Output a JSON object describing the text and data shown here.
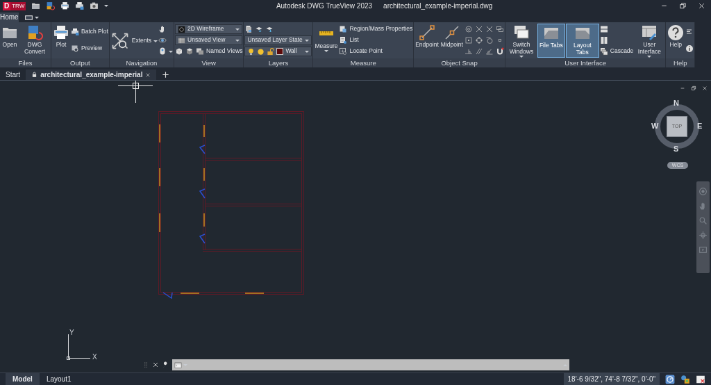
{
  "window": {
    "title": "Autodesk DWG TrueView 2023",
    "document": "architectural_example-imperial.dwg"
  },
  "logo": {
    "letter": "D",
    "text": "TRW"
  },
  "ribbon_tabs": [
    {
      "label": "Home",
      "selected": true
    },
    {
      "kind": "icon",
      "selected": false
    }
  ],
  "panels": [
    {
      "title": "Files",
      "columns": [
        {
          "kind": "large",
          "label": "Open"
        },
        {
          "kind": "large",
          "label": "DWG Convert"
        }
      ]
    },
    {
      "title": "Output",
      "columns": [
        {
          "kind": "large",
          "label": "Plot"
        },
        {
          "kind": "stack",
          "rows": [
            [
              {
                "kind": "small",
                "label": "Batch Plot"
              }
            ],
            [
              {
                "kind": "small",
                "label": "Preview"
              }
            ]
          ]
        }
      ]
    },
    {
      "title": "Navigation",
      "columns": [
        {
          "kind": "wide",
          "label": "Extents",
          "menu": true
        },
        {
          "kind": "stack",
          "rows": [
            [
              {
                "kind": "icon"
              }
            ],
            [
              {
                "kind": "icon"
              }
            ],
            [
              {
                "kind": "icon",
                "menu": true
              }
            ]
          ]
        }
      ]
    },
    {
      "title": "View",
      "columns": [
        {
          "kind": "stack",
          "rows": [
            [
              {
                "kind": "dropdown",
                "value": "2D Wireframe"
              }
            ],
            [
              {
                "kind": "dropdown",
                "value": "Unsaved View"
              }
            ],
            [
              {
                "kind": "icon"
              },
              {
                "kind": "icon"
              },
              {
                "kind": "small",
                "label": "Named Views"
              }
            ]
          ]
        }
      ]
    },
    {
      "title": "Layers",
      "columns": [
        {
          "kind": "stack",
          "rows": [
            [
              {
                "kind": "icon"
              },
              {
                "kind": "icon"
              },
              {
                "kind": "icon"
              }
            ],
            [
              {
                "kind": "dropdown",
                "value": "Unsaved Layer State"
              }
            ],
            [
              {
                "kind": "layer",
                "value": "Wall",
                "color": "#5c0a0a",
                "on": true,
                "frozen": false,
                "locked": false
              }
            ]
          ]
        }
      ]
    },
    {
      "title": "Measure",
      "columns": [
        {
          "kind": "large",
          "label": "Measure",
          "menu": true
        },
        {
          "kind": "stack",
          "rows": [
            [
              {
                "kind": "small",
                "label": "Region/Mass Properties"
              }
            ],
            [
              {
                "kind": "small",
                "label": "List"
              }
            ],
            [
              {
                "kind": "small",
                "label": "Locate Point"
              }
            ]
          ]
        }
      ]
    },
    {
      "title": "Object Snap",
      "columns": [
        {
          "kind": "large",
          "label": "Endpoint"
        },
        {
          "kind": "large",
          "label": "Midpoint"
        },
        {
          "kind": "stack",
          "rows": [
            [
              {
                "kind": "icon"
              },
              {
                "kind": "icon"
              },
              {
                "kind": "icon"
              },
              {
                "kind": "icon"
              }
            ],
            [
              {
                "kind": "icon"
              },
              {
                "kind": "icon"
              },
              {
                "kind": "icon"
              },
              {
                "kind": "icon"
              }
            ],
            [
              {
                "kind": "icon"
              },
              {
                "kind": "icon"
              },
              {
                "kind": "icon"
              },
              {
                "kind": "icon"
              }
            ]
          ]
        }
      ]
    },
    {
      "title": "User Interface",
      "columns": [
        {
          "kind": "large",
          "label": "Switch Windows",
          "menu": true
        },
        {
          "kind": "large",
          "label": "File Tabs",
          "selected": true
        },
        {
          "kind": "large",
          "label": "Layout Tabs",
          "selected": true
        },
        {
          "kind": "stack",
          "rows": [
            [
              {
                "kind": "icon"
              }
            ],
            [
              {
                "kind": "icon"
              }
            ],
            [
              {
                "kind": "small",
                "label": "Cascade"
              }
            ]
          ]
        },
        {
          "kind": "large",
          "label": "User Interface",
          "menu": true
        }
      ]
    },
    {
      "title": "Help",
      "columns": [
        {
          "kind": "large",
          "label": "Help"
        },
        {
          "kind": "stack",
          "rows": [
            [
              {
                "kind": "icon"
              }
            ],
            [
              {
                "kind": "icon"
              }
            ]
          ]
        }
      ]
    }
  ],
  "file_tabs": [
    {
      "label": "Start",
      "selected": false,
      "locked": false
    },
    {
      "label": "architectural_example-imperial",
      "selected": true,
      "locked": true
    }
  ],
  "viewcube": {
    "north": "N",
    "west": "W",
    "east": "E",
    "south": "S",
    "face": "TOP",
    "ucs": "WCS"
  },
  "ucs_icon": {
    "y": "Y",
    "x": "X"
  },
  "layout_tabs": [
    {
      "label": "Model",
      "selected": true
    },
    {
      "label": "Layout1",
      "selected": false
    }
  ],
  "status_bar": {
    "coordinates": "18'-6 9/32\", 74'-8 7/32\", 0'-0\""
  }
}
